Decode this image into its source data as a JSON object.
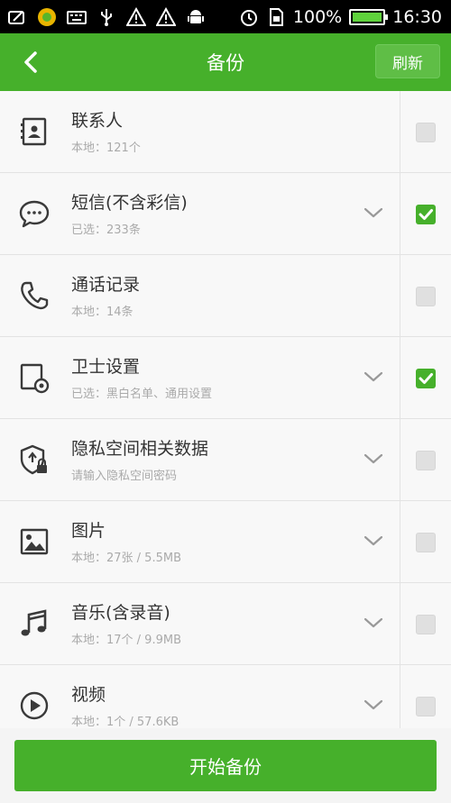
{
  "status_bar": {
    "battery_text": "100%",
    "time": "16:30"
  },
  "header": {
    "title": "备份",
    "refresh_label": "刷新"
  },
  "items": [
    {
      "name": "联系人",
      "sub": "本地：121个",
      "icon": "contacts-icon",
      "has_chevron": false,
      "checked": false
    },
    {
      "name": "短信(不含彩信)",
      "sub": "已选：233条",
      "icon": "sms-icon",
      "has_chevron": true,
      "checked": true
    },
    {
      "name": "通话记录",
      "sub": "本地：14条",
      "icon": "phone-icon",
      "has_chevron": false,
      "checked": false
    },
    {
      "name": "卫士设置",
      "sub": "已选：黑白名单、通用设置",
      "icon": "settings-icon",
      "has_chevron": true,
      "checked": true
    },
    {
      "name": "隐私空间相关数据",
      "sub": "请输入隐私空间密码",
      "icon": "privacy-shield-icon",
      "has_chevron": true,
      "checked": false
    },
    {
      "name": "图片",
      "sub": "本地：27张 / 5.5MB",
      "icon": "image-icon",
      "has_chevron": true,
      "checked": false
    },
    {
      "name": "音乐(含录音)",
      "sub": "本地：17个 / 9.9MB",
      "icon": "music-icon",
      "has_chevron": true,
      "checked": false
    },
    {
      "name": "视频",
      "sub": "本地：1个 / 57.6KB",
      "icon": "video-icon",
      "has_chevron": true,
      "checked": false
    }
  ],
  "footer": {
    "start_button": "开始备份"
  },
  "colors": {
    "accent": "#46b02b",
    "status_bar": "#000000"
  }
}
